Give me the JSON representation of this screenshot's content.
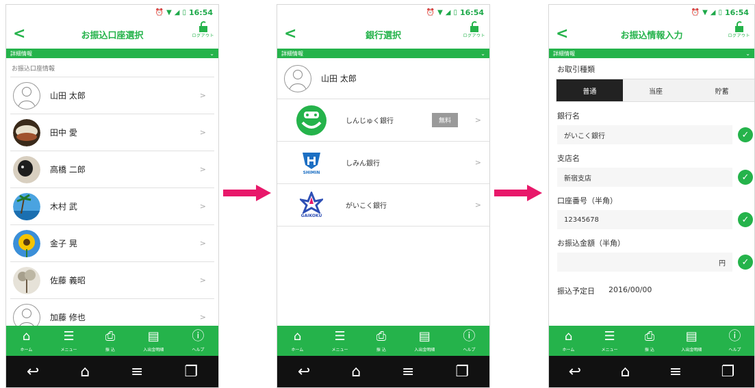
{
  "status": {
    "time": "16:54"
  },
  "common": {
    "logout_label": "ログアウト",
    "detail_label": "詳細情報",
    "tabs": [
      {
        "icon": "home-icon",
        "label": "ホーム"
      },
      {
        "icon": "menu-icon",
        "label": "メニュー"
      },
      {
        "icon": "transfer-icon",
        "label": "振 込"
      },
      {
        "icon": "statement-icon",
        "label": "入出金明細"
      },
      {
        "icon": "help-icon",
        "label": "ヘルプ"
      }
    ]
  },
  "screen1": {
    "title": "お振込口座選択",
    "section_label": "お振込口座情報",
    "accounts": [
      {
        "name": "山田 太郎",
        "avatar": "default"
      },
      {
        "name": "田中 愛",
        "avatar": "rice-bowl-photo"
      },
      {
        "name": "高橋 二郎",
        "avatar": "dog-photo"
      },
      {
        "name": "木村 武",
        "avatar": "palm-tree-photo"
      },
      {
        "name": "金子 晃",
        "avatar": "sunflower-photo"
      },
      {
        "name": "佐藤 義昭",
        "avatar": "tree-photo"
      },
      {
        "name": "加藤 修也",
        "avatar": "default"
      }
    ]
  },
  "screen2": {
    "title": "銀行選択",
    "user_name": "山田 太郎",
    "banks": [
      {
        "name": "しんじゅく銀行",
        "badge": "無料"
      },
      {
        "name": "しみん銀行",
        "logo_text": "SHIMIN"
      },
      {
        "name": "がいこく銀行",
        "logo_text": "GAIKOKU"
      }
    ]
  },
  "screen3": {
    "title": "お振込情報入力",
    "type_label": "お取引種類",
    "type_options": [
      "普通",
      "当座",
      "貯蓄"
    ],
    "type_selected": "普通",
    "bank_label": "銀行名",
    "bank_value": "がいこく銀行",
    "branch_label": "支店名",
    "branch_value": "新宿支店",
    "account_label": "口座番号（半角）",
    "account_value": "12345678",
    "amount_label": "お振込金額（半角）",
    "amount_value": "",
    "amount_unit": "円",
    "date_label": "振込予定日",
    "date_value": "2016/00/00"
  },
  "colors": {
    "accent": "#25b34b",
    "arrow": "#e8186a",
    "navbar": "#111111"
  }
}
